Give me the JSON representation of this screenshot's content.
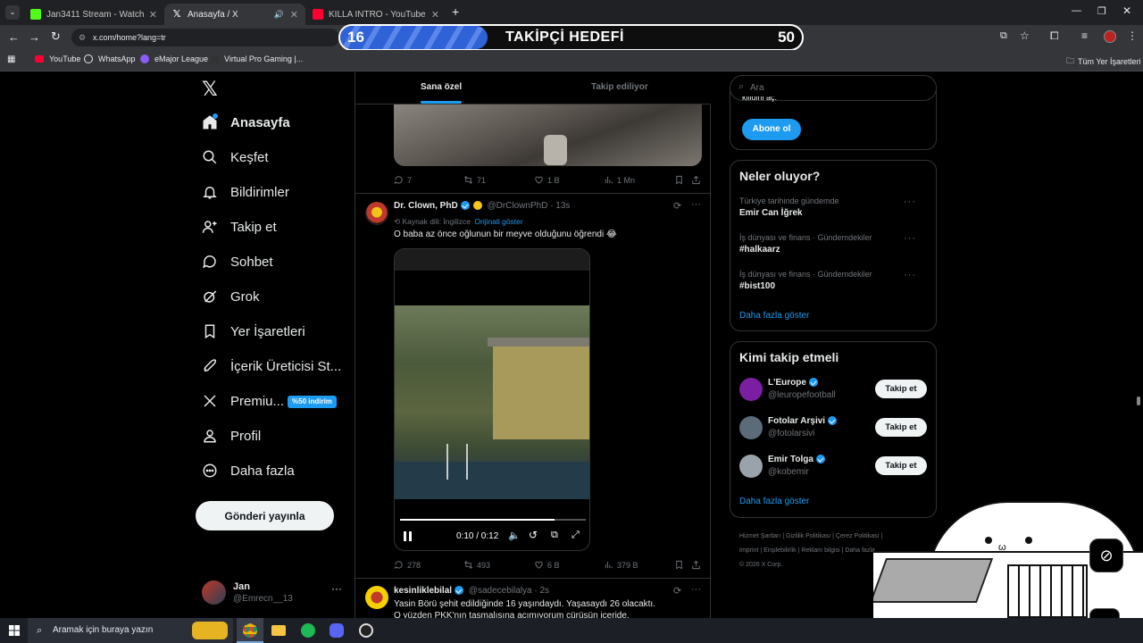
{
  "browser": {
    "tabs": [
      {
        "title": "Jan3411 Stream - Watch Live o",
        "fav": "#53fc18"
      },
      {
        "title": "Anasayfa / X",
        "fav": "#ffffff"
      },
      {
        "title": "KILLA INTRO - YouTube",
        "fav": "#ff0033"
      }
    ],
    "url": "x.com/home?lang=tr",
    "bookmarks": [
      "YouTube",
      "WhatsApp",
      "eMajor League",
      "Virtual Pro Gaming |..."
    ],
    "all_bookmarks": "Tüm Yer İşaretleri"
  },
  "overlay": {
    "current": "16",
    "label": "TAKİPÇİ HEDEFİ",
    "goal": "50",
    "progress": 0.32
  },
  "sidebar": {
    "items": [
      {
        "label": "Anasayfa",
        "icon": "home-icon"
      },
      {
        "label": "Keşfet",
        "icon": "search-icon"
      },
      {
        "label": "Bildirimler",
        "icon": "bell-icon"
      },
      {
        "label": "Takip et",
        "icon": "person-plus-icon"
      },
      {
        "label": "Sohbet",
        "icon": "chat-icon"
      },
      {
        "label": "Grok",
        "icon": "grok-icon"
      },
      {
        "label": "Yer İşaretleri",
        "icon": "bookmark-icon"
      },
      {
        "label": "İçerik Üreticisi St...",
        "icon": "rocket-icon"
      },
      {
        "label": "Premiu...",
        "icon": "x-logo-icon"
      },
      {
        "label": "Profil",
        "icon": "profile-icon"
      },
      {
        "label": "Daha fazla",
        "icon": "more-icon"
      }
    ],
    "premium_badge": "%50 indirim",
    "post_button": "Gönderi yayınla",
    "user": {
      "name": "Jan",
      "handle": "@Emrecn__13"
    }
  },
  "feed": {
    "tabs": [
      "Sana özel",
      "Takip ediliyor"
    ],
    "prev_stats": {
      "replies": "7",
      "reposts": "71",
      "likes": "1 B",
      "views": "1 Mn"
    },
    "tweet": {
      "name": "Dr. Clown, PhD",
      "handle": "@DrClownPhD",
      "time": "· 13s",
      "source_lang": "Kaynak dili: İngilizce",
      "show_original": "Orijinali göster",
      "text": "O baba az önce oğlunun bir meyve olduğunu öğrendi 😂",
      "video_time": "0:10 / 0:12",
      "video_progress": 0.83,
      "stats": {
        "replies": "278",
        "reposts": "493",
        "likes": "6 B",
        "views": "379 B"
      }
    },
    "next_tweet": {
      "name": "kesinliklebilal",
      "handle": "@sadecebilalya",
      "time": "· 2s",
      "text1": "Yasin Börü şehit edildiğinde 16 yaşındaydı. Yaşasaydı 26 olacaktı.",
      "text2": "O yüzden PKK'nın tasmalısına acımıyorum cürüsün içeride."
    }
  },
  "right": {
    "search_placeholder": "Ara",
    "sub_cut_text": "kilidini aç.",
    "subscribe": "Abone ol",
    "trends_title": "Neler oluyor?",
    "trends": [
      {
        "category": "Türkiye tarihinde gündemde",
        "name": "Emir Can İğrek"
      },
      {
        "category": "İş dünyası ve finans · Gündemdekiler",
        "name": "#halkaarz"
      },
      {
        "category": "İş dünyası ve finans · Gündemdekiler",
        "name": "#bist100"
      }
    ],
    "show_more": "Daha fazla göster",
    "who_title": "Kimi takip etmeli",
    "who": [
      {
        "name": "L'Europe",
        "handle": "@leuropefootball",
        "color": "#7b1fa2"
      },
      {
        "name": "Fotolar Arşivi",
        "handle": "@fotolarsivi",
        "color": "#5b6b7a"
      },
      {
        "name": "Emir Tolga",
        "handle": "@kobemir",
        "color": "#9aa3ab"
      }
    ],
    "follow_label": "Takip et",
    "footer1": [
      "Hizmet Şartları",
      "Gizlilik Politikası",
      "Çerez Politikası"
    ],
    "footer2": [
      "Imprint",
      "Erişilebilirlik",
      "Reklam bilgisi",
      "Daha fazla ..."
    ],
    "copyright": "© 2026 X Corp."
  },
  "taskbar": {
    "search": "Aramak için buraya yazın"
  }
}
